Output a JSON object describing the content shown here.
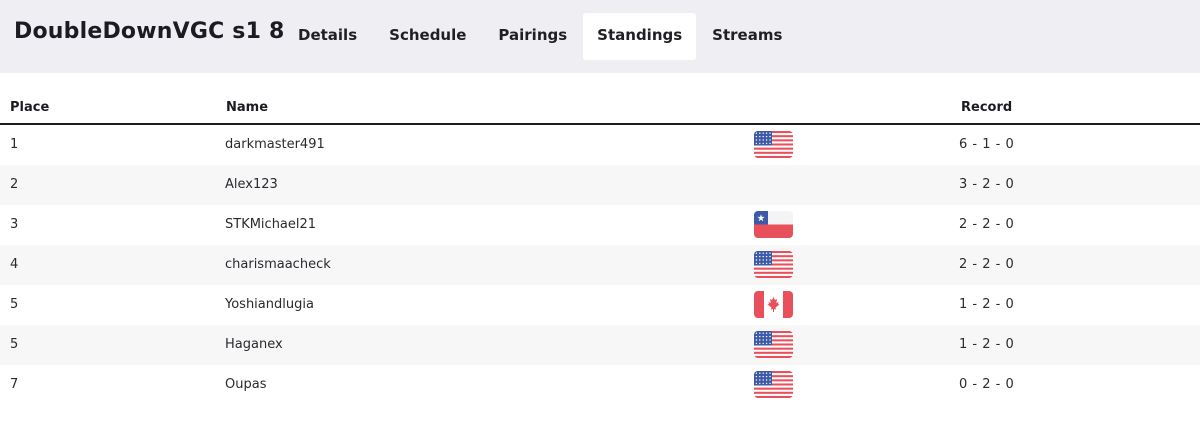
{
  "header": {
    "title": "DoubleDownVGC s1 8",
    "tabs": [
      {
        "label": "Details"
      },
      {
        "label": "Schedule"
      },
      {
        "label": "Pairings"
      },
      {
        "label": "Standings"
      },
      {
        "label": "Streams"
      }
    ],
    "active_tab": "Standings"
  },
  "standings": {
    "columns": {
      "place": "Place",
      "name": "Name",
      "record": "Record"
    },
    "rows": [
      {
        "place": "1",
        "name": "darkmaster491",
        "flag": "flag-us-icon",
        "record": "6 - 1 - 0"
      },
      {
        "place": "2",
        "name": "Alex123",
        "flag": "",
        "record": "3 - 2 - 0"
      },
      {
        "place": "3",
        "name": "STKMichael21",
        "flag": "flag-cl-icon",
        "record": "2 - 2 - 0"
      },
      {
        "place": "4",
        "name": "charismaacheck",
        "flag": "flag-us-icon",
        "record": "2 - 2 - 0"
      },
      {
        "place": "5",
        "name": "Yoshiandlugia",
        "flag": "flag-ca-icon",
        "record": "1 - 2 - 0"
      },
      {
        "place": "5",
        "name": "Haganex",
        "flag": "flag-us-icon",
        "record": "1 - 2 - 0"
      },
      {
        "place": "7",
        "name": "Oupas",
        "flag": "flag-us-icon",
        "record": "0 - 2 - 0"
      }
    ]
  },
  "colors": {
    "topbar_bg": "#efeff3",
    "row_alt_bg": "#f7f7f7",
    "flag_red": "#e8505b",
    "flag_blue": "#3c5aa6"
  }
}
